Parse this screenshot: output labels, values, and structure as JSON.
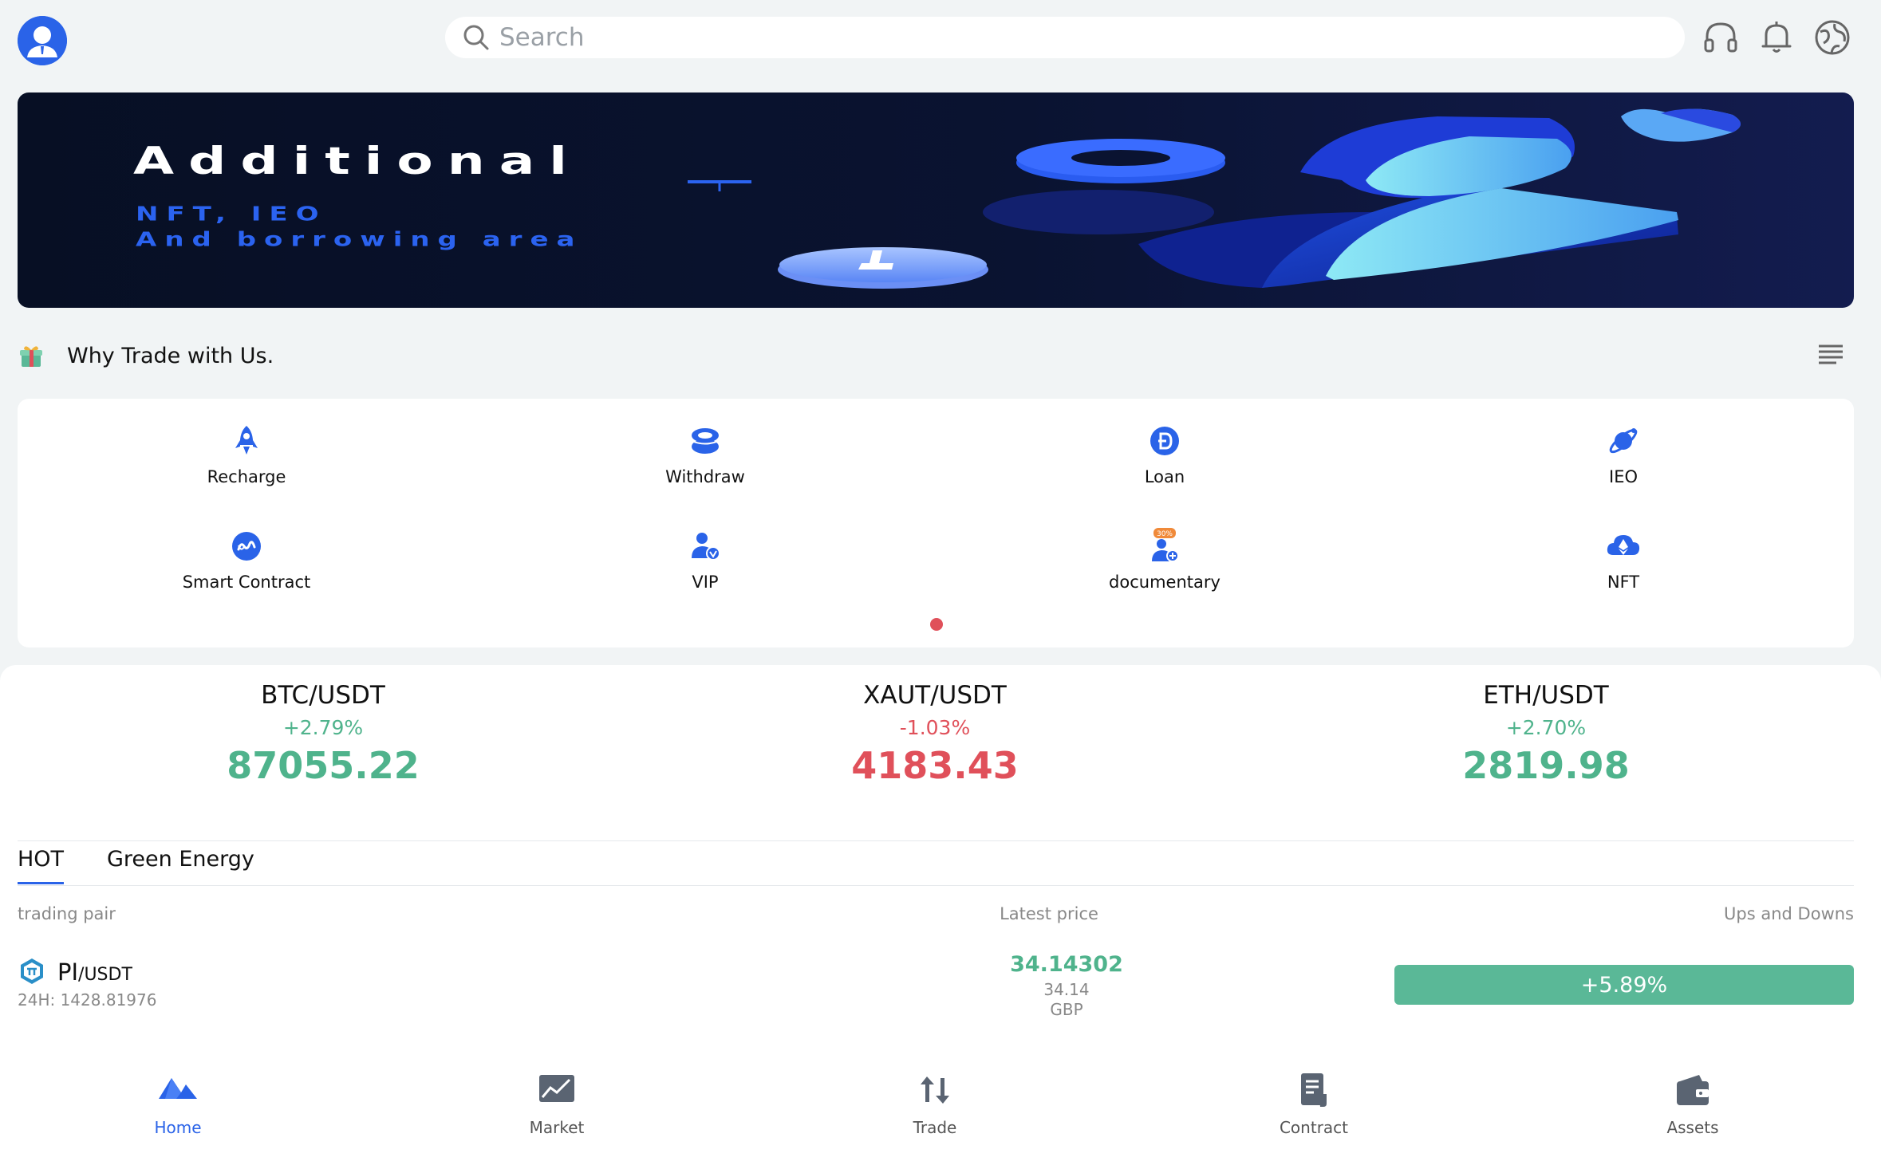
{
  "header": {
    "search_placeholder": "Search",
    "icons": [
      "user-avatar",
      "headset-icon",
      "bell-icon",
      "globe-icon"
    ]
  },
  "banner": {
    "title": "Additional",
    "subtitle_line1": "NFT, IEO",
    "subtitle_line2": "And borrowing area"
  },
  "section": {
    "title": "Why Trade with Us."
  },
  "actions": [
    {
      "label": "Recharge",
      "icon": "rocket-icon"
    },
    {
      "label": "Withdraw",
      "icon": "coin-stack-icon"
    },
    {
      "label": "Loan",
      "icon": "doge-coin-icon"
    },
    {
      "label": "IEO",
      "icon": "planet-icon"
    },
    {
      "label": "Smart Contract",
      "icon": "smart-contract-icon"
    },
    {
      "label": "VIP",
      "icon": "vip-user-icon"
    },
    {
      "label": "documentary",
      "icon": "copy-trade-user-icon",
      "badge": "30%"
    },
    {
      "label": "NFT",
      "icon": "cloud-ethereum-icon"
    }
  ],
  "tickers": [
    {
      "pair": "BTC/USDT",
      "change": "+2.79%",
      "price": "87055.22",
      "direction": "up"
    },
    {
      "pair": "XAUT/USDT",
      "change": "-1.03%",
      "price": "4183.43",
      "direction": "down"
    },
    {
      "pair": "ETH/USDT",
      "change": "+2.70%",
      "price": "2819.98",
      "direction": "up"
    }
  ],
  "tabs": [
    {
      "label": "HOT",
      "active": true
    },
    {
      "label": "Green Energy",
      "active": false
    }
  ],
  "table": {
    "headers": {
      "pair": "trading pair",
      "latest": "Latest price",
      "change": "Ups and Downs"
    },
    "rows": [
      {
        "base": "PI",
        "quote": "/USDT",
        "volume": "24H: 1428.81976",
        "latest": "34.14302",
        "fiat_value": "34.14",
        "fiat": "GBP",
        "change": "+5.89%"
      }
    ]
  },
  "nav": [
    {
      "label": "Home",
      "active": true,
      "icon": "home-mountain-icon"
    },
    {
      "label": "Market",
      "active": false,
      "icon": "market-chart-icon"
    },
    {
      "label": "Trade",
      "active": false,
      "icon": "trade-arrows-icon"
    },
    {
      "label": "Contract",
      "active": false,
      "icon": "contract-document-icon"
    },
    {
      "label": "Assets",
      "active": false,
      "icon": "wallet-icon"
    }
  ],
  "colors": {
    "accent": "#2a63e8",
    "up": "#4fb38c",
    "down": "#e0505a",
    "badge": "#5ab897"
  }
}
